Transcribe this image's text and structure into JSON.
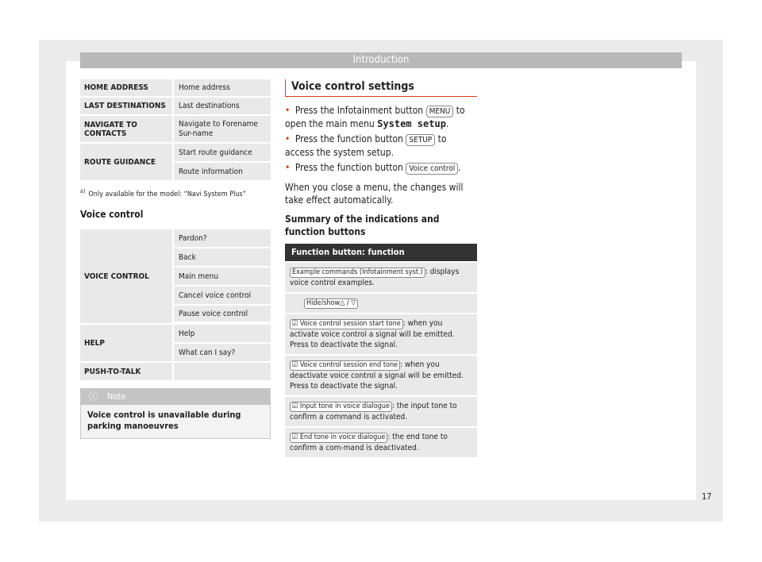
{
  "header": {
    "title": "Introduction"
  },
  "nav_table": [
    {
      "label": "HOME ADDRESS",
      "values": [
        "Home address"
      ]
    },
    {
      "label": "LAST DESTINATIONS",
      "values": [
        "Last destinations"
      ]
    },
    {
      "label": "NAVIGATE TO CONTACTS",
      "values": [
        "Navigate to Forename Sur-name"
      ]
    },
    {
      "label": "ROUTE GUIDANCE",
      "values": [
        "Start route guidance",
        "Route information"
      ]
    }
  ],
  "footnote": {
    "marker": "a)",
    "text": "Only available for the model: “Navi System Plus”"
  },
  "voice_heading": "Voice control",
  "voice_table": [
    {
      "label": "VOICE CONTROL",
      "values": [
        "Pardon?",
        "Back",
        "Main menu",
        "Cancel voice control",
        "Pause voice control"
      ]
    },
    {
      "label": "HELP",
      "values": [
        "Help",
        "What can I say?"
      ]
    },
    {
      "label": "PUSH-TO-TALK",
      "values": [
        ""
      ]
    }
  ],
  "note": {
    "label": "Note",
    "text": "Voice control is unavailable during parking manoeuvres"
  },
  "settings": {
    "title": "Voice control settings",
    "b1_pre": "Press the Infotainment button",
    "b1_key": "MENU",
    "b1_mid": "to open the main menu",
    "b1_mono": "System setup",
    "b1_end": ".",
    "b2_pre": "Press the function button",
    "b2_key": "SETUP",
    "b2_end": "to access the system setup.",
    "b3_pre": "Press the function button",
    "b3_key": "Voice control",
    "b3_end": ".",
    "para": "When you close a menu, the changes will take effect automatically.",
    "summary": "Summary of the indications and function buttons"
  },
  "func_table": {
    "header": "Function button: function",
    "rows": [
      {
        "key": "Example commands (Infotainment syst.)",
        "text": ": displays voice control examples."
      },
      {
        "key": "Hide/show△ / ▽",
        "text": ""
      },
      {
        "key": "☑ Voice control session start tone",
        "text": ": when you activate voice control a signal will be emitted. Press to deactivate the signal."
      },
      {
        "key": "☑ Voice control session end tone",
        "text": ": when you deactivate voice control a signal will be emitted. Press to deactivate the signal."
      },
      {
        "key": "☑ Input tone in voice dialogue",
        "text": ": the input tone to confirm a command is activated."
      },
      {
        "key": "☑ End tone in voice dialogue",
        "text": ": the end tone to confirm a com-mand is deactivated."
      }
    ]
  },
  "page_number": "17"
}
